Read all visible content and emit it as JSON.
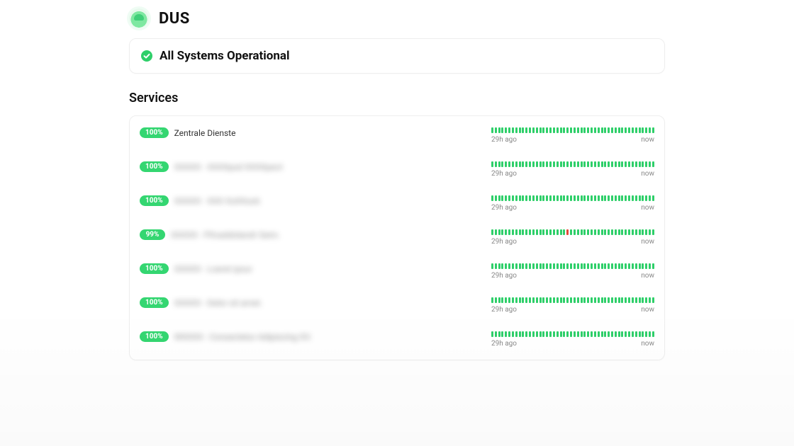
{
  "brand": {
    "name": "DUS"
  },
  "status": {
    "headline": "All Systems Operational"
  },
  "sections": {
    "services_title": "Services",
    "time_start_label": "29h ago",
    "time_end_label": "now"
  },
  "services": [
    {
      "uptime": "100%",
      "name": "Zentrale Dienste",
      "redacted": false,
      "bars_total": 48,
      "incident_indices": []
    },
    {
      "uptime": "100%",
      "name": "XXXXX  -  XXXXpsd XXXXpect",
      "redacted": true,
      "bars_total": 48,
      "incident_indices": []
    },
    {
      "uptime": "100%",
      "name": "XXXXX  -  XXX XsXXssit.",
      "redacted": true,
      "bars_total": 48,
      "incident_indices": []
    },
    {
      "uptime": "99%",
      "name": "XXXXX  -  PXvaddolandr Seim.",
      "redacted": true,
      "bars_total": 48,
      "incident_indices": [
        22
      ]
    },
    {
      "uptime": "100%",
      "name": "XXXXX  -  Loeret ipsur",
      "redacted": true,
      "bars_total": 48,
      "incident_indices": []
    },
    {
      "uptime": "100%",
      "name": "XXXXX  -  Delor sit amet.",
      "redacted": true,
      "bars_total": 48,
      "incident_indices": []
    },
    {
      "uptime": "100%",
      "name": "WXXXX  -  Consectetur Adipiscing XV.",
      "redacted": true,
      "bars_total": 48,
      "incident_indices": []
    }
  ],
  "colors": {
    "green": "#2ecf69",
    "pill_green": "#34d671",
    "red": "#e44a3a"
  }
}
